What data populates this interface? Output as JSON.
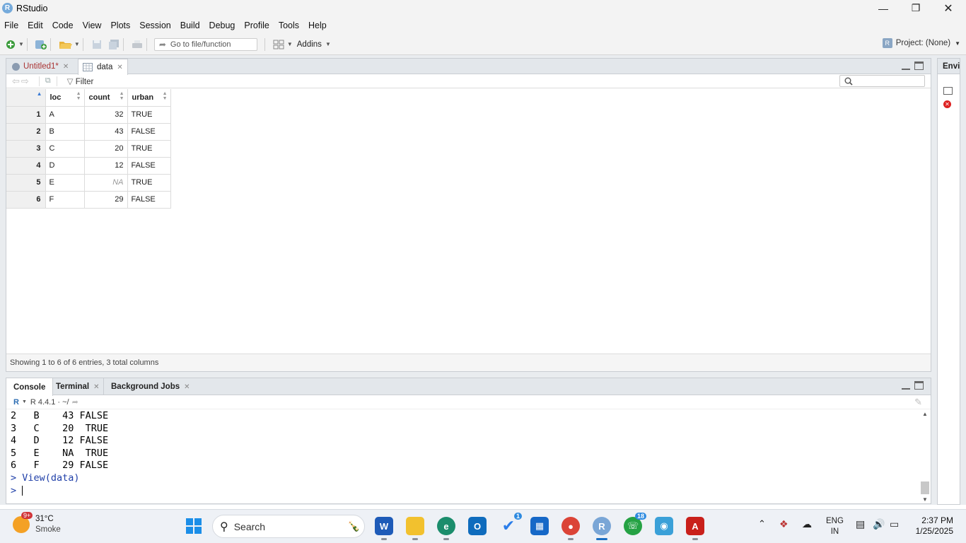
{
  "window": {
    "title": "RStudio"
  },
  "menu": [
    "File",
    "Edit",
    "Code",
    "View",
    "Plots",
    "Session",
    "Build",
    "Debug",
    "Profile",
    "Tools",
    "Help"
  ],
  "toolbar": {
    "goto_placeholder": "Go to file/function",
    "addins_label": "Addins",
    "project_label": "Project: (None)"
  },
  "source": {
    "tabs": [
      {
        "label": "Untitled1*"
      },
      {
        "label": "data"
      }
    ],
    "filter_label": "Filter",
    "columns": [
      "loc",
      "count",
      "urban"
    ],
    "rows": [
      [
        "1",
        "A",
        "32",
        "TRUE"
      ],
      [
        "2",
        "B",
        "43",
        "FALSE"
      ],
      [
        "3",
        "C",
        "20",
        "TRUE"
      ],
      [
        "4",
        "D",
        "12",
        "FALSE"
      ],
      [
        "5",
        "E",
        "NA",
        "TRUE"
      ],
      [
        "6",
        "F",
        "29",
        "FALSE"
      ]
    ],
    "status": "Showing 1 to 6 of 6 entries, 3 total columns"
  },
  "console": {
    "tabs": [
      "Console",
      "Terminal",
      "Background Jobs"
    ],
    "r_version": "R 4.4.1 · ~/",
    "lines": [
      "2   B    43 FALSE",
      "3   C    20  TRUE",
      "4   D    12 FALSE",
      "5   E    NA  TRUE",
      "6   F    29 FALSE"
    ],
    "command": "> View(data)",
    "prompt": "> "
  },
  "right_pane": {
    "tab_label": "Envi"
  },
  "taskbar": {
    "weather_temp": "31°C",
    "weather_desc": "Smoke",
    "weather_badge": "9+",
    "search_label": "Search",
    "todo_badge": "1",
    "whatsapp_badge": "18",
    "lang_top": "ENG",
    "lang_bottom": "IN",
    "time": "2:37 PM",
    "date": "1/25/2025"
  }
}
